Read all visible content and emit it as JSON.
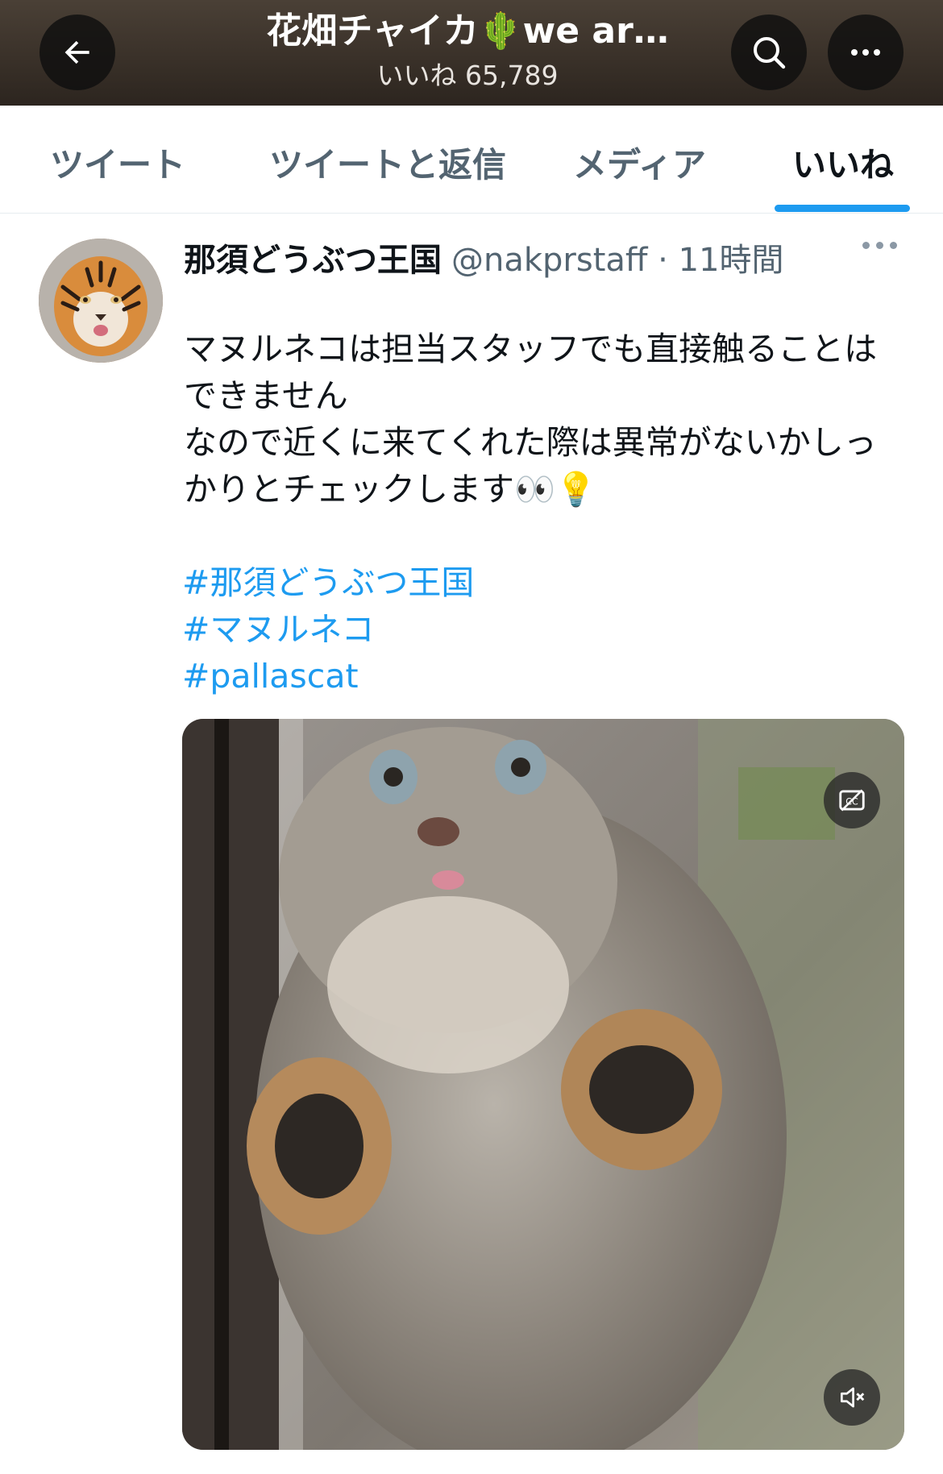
{
  "header": {
    "title": "花畑チャイカ🌵we ar…",
    "subtitle": "いいね 65,789",
    "back_icon": "arrow-left-icon",
    "search_icon": "search-icon",
    "more_icon": "more-horizontal-icon"
  },
  "tabs": [
    {
      "label": "ツイート",
      "active": false
    },
    {
      "label": "ツイートと返信",
      "active": false
    },
    {
      "label": "メディア",
      "active": false
    },
    {
      "label": "いいね",
      "active": true
    }
  ],
  "tweet": {
    "author_name": "那須どうぶつ王国",
    "handle": "@nakprstaff",
    "separator": " · ",
    "time": "11時間",
    "text_lines": [
      "マヌルネコは担当スタッフでも直接触ることは",
      "できません",
      "なので近くに来てくれた際は異常がないかしっ",
      "かりとチェックします👀💡"
    ],
    "hashtags": [
      "#那須どうぶつ王国",
      "#マヌルネコ",
      "#pallascat"
    ],
    "media": {
      "captions_icon": "closed-captions-icon",
      "mute_icon": "speaker-muted-icon"
    }
  },
  "colors": {
    "accent": "#1d9bf0",
    "text_primary": "#0f1419",
    "text_secondary": "#536471"
  }
}
